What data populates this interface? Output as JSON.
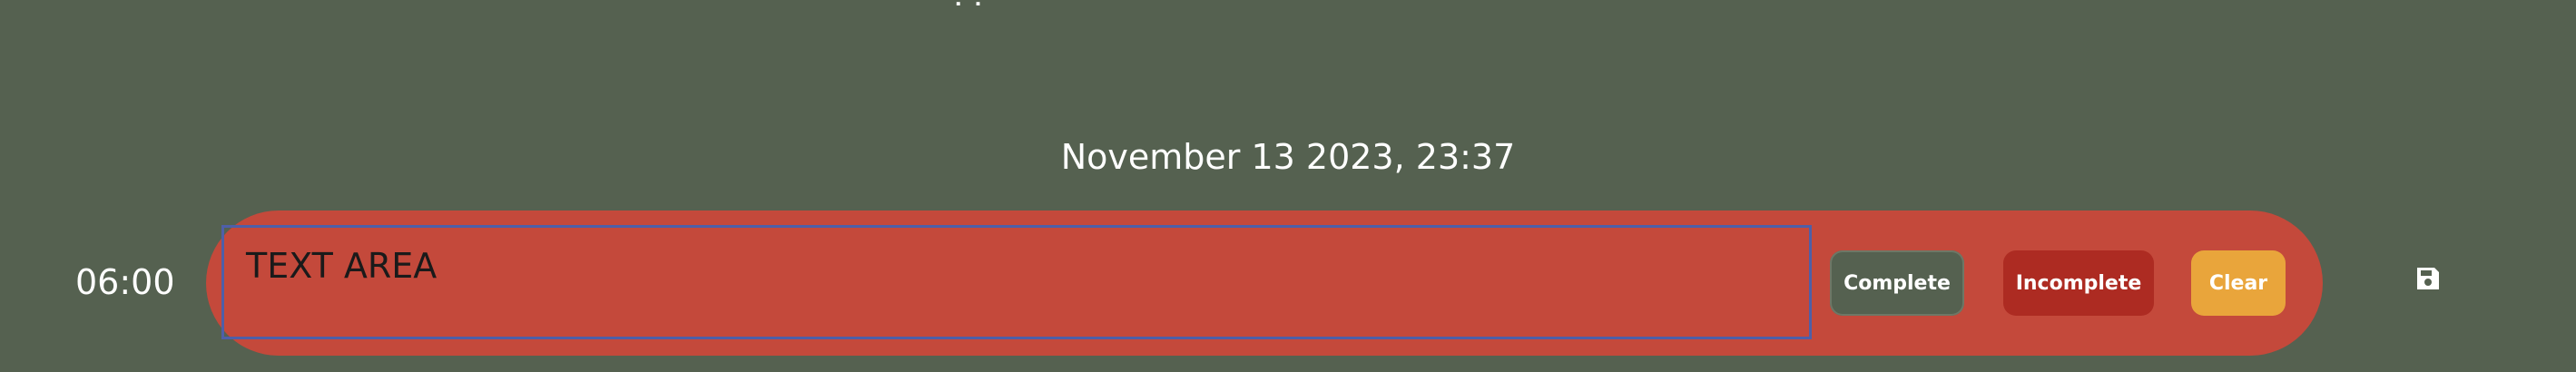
{
  "header": {
    "date": "November 13 2023, 23:37"
  },
  "schedule_row": {
    "time": "06:00",
    "text_area_placeholder": "TEXT AREA",
    "buttons": {
      "complete_label": "Complete",
      "incomplete_label": "Incomplete",
      "clear_label": "Clear"
    },
    "save_icon": "floppy-disk-icon"
  },
  "colors": {
    "background": "#556150",
    "row_background": "#c4493b",
    "complete_button": "#556150",
    "incomplete_button": "#ad2b22",
    "clear_button": "#e9a53b",
    "text_area_border": "#4e5fa8"
  }
}
